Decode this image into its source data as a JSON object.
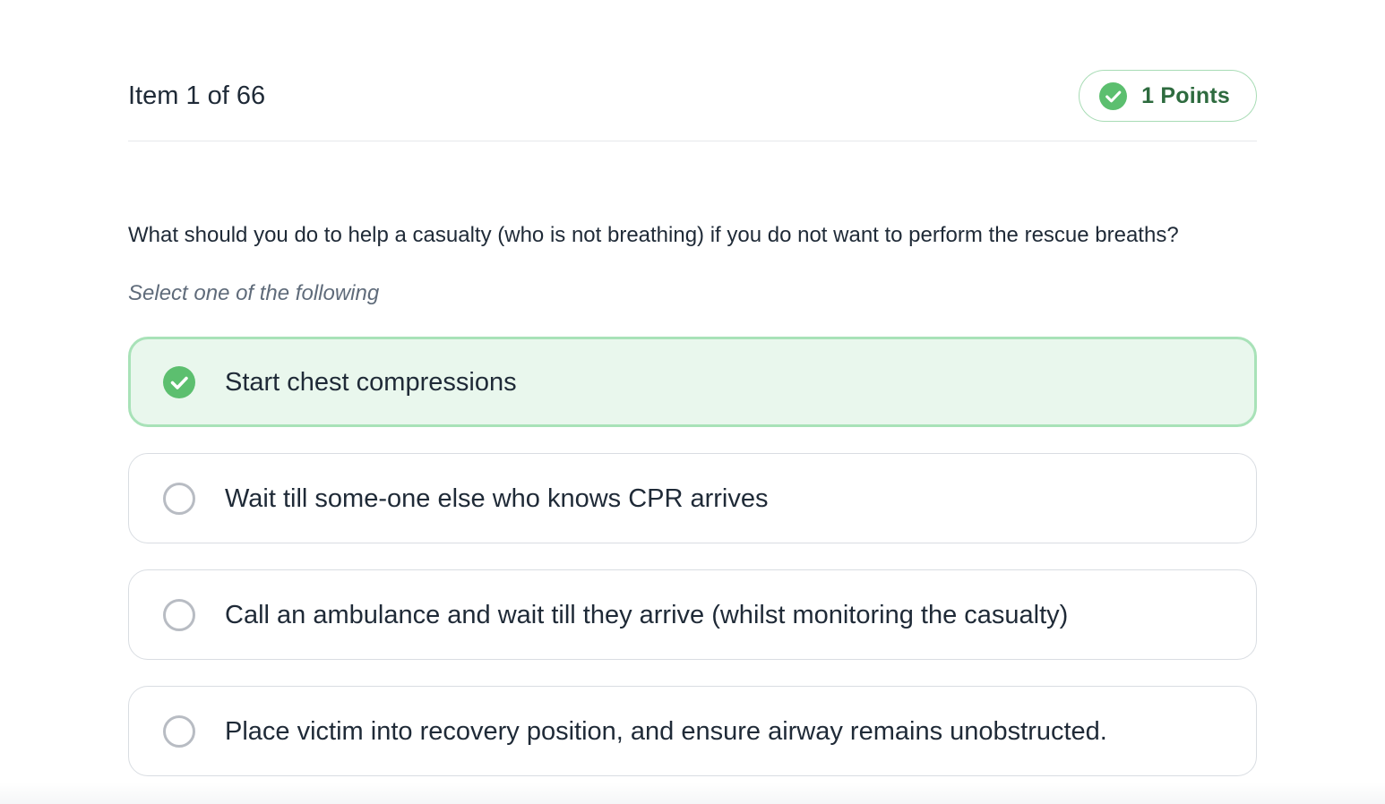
{
  "header": {
    "item_counter": "Item 1 of 66",
    "points_label": "1 Points",
    "points_icon": "check-circle-icon"
  },
  "question": {
    "text": "What should you do to help a casualty (who is not breathing) if you do not want to perform the rescue breaths?",
    "instruction": "Select one of the following"
  },
  "options": [
    {
      "label": "Start chest compressions",
      "selected": true,
      "icon": "check-circle-icon"
    },
    {
      "label": "Wait till some-one else who knows CPR arrives",
      "selected": false,
      "icon": "radio-empty-icon"
    },
    {
      "label": "Call an ambulance and wait till they arrive (whilst monitoring the casualty)",
      "selected": false,
      "icon": "radio-empty-icon"
    },
    {
      "label": "Place victim into recovery position, and ensure airway remains unobstructed.",
      "selected": false,
      "icon": "radio-empty-icon"
    }
  ],
  "colors": {
    "accent_green": "#5cbf6f",
    "selected_bg": "#e9f7ed",
    "selected_border": "#a8e2b8",
    "text": "#1f2a37",
    "muted_text": "#5f6b7a"
  }
}
